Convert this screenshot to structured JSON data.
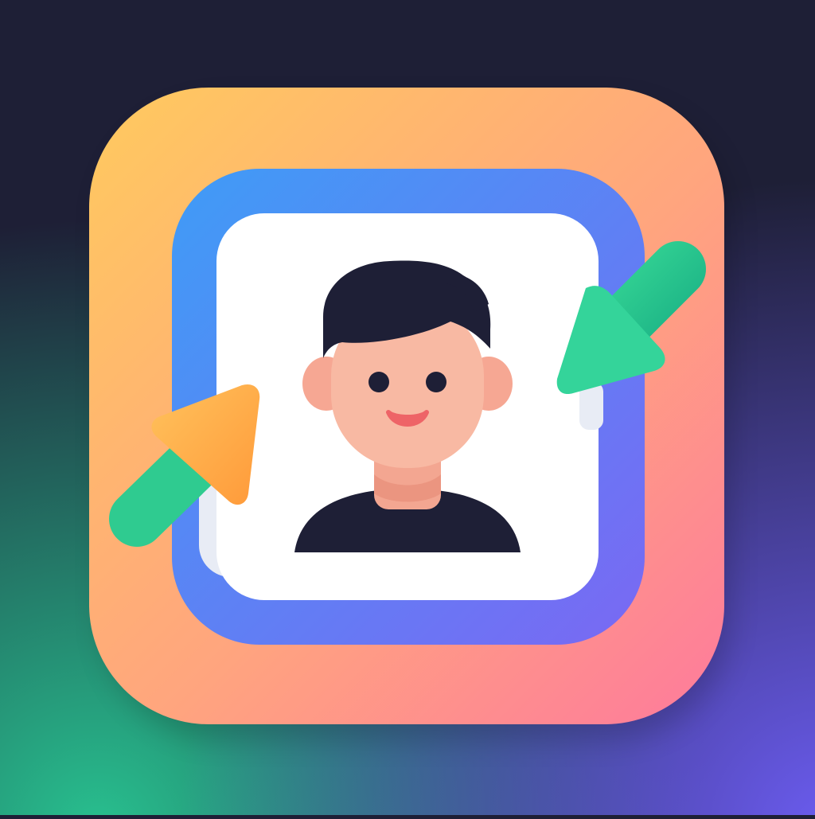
{
  "icon": {
    "type": "app-icon",
    "subject": "profile-swap",
    "colors": {
      "background_top": "#1e1f36",
      "background_bottom_left": "#28c08f",
      "background_bottom_right": "#6b5cf0",
      "tile_gradient_start": "#ffca5e",
      "tile_gradient_end": "#fe7a9c",
      "frame_gradient_start": "#3f9cf6",
      "frame_gradient_end": "#7a68f3",
      "card": "#ffffff",
      "card_shadow": "#e8ecf5",
      "hair": "#1e1f36",
      "skin": "#f8b9a3",
      "ear": "#f6a793",
      "neck": "#f3a691",
      "shirt": "#1e1f36",
      "mouth": "#ee6467",
      "arrow_green": "#2fcb90",
      "arrow_green_dark": "#1fb787",
      "arrow_orange_start": "#ffbd59",
      "arrow_orange_end": "#ff9e3d"
    },
    "icons": [
      "avatar-icon",
      "arrow-in-top-right-icon",
      "arrow-in-bottom-left-icon"
    ]
  }
}
